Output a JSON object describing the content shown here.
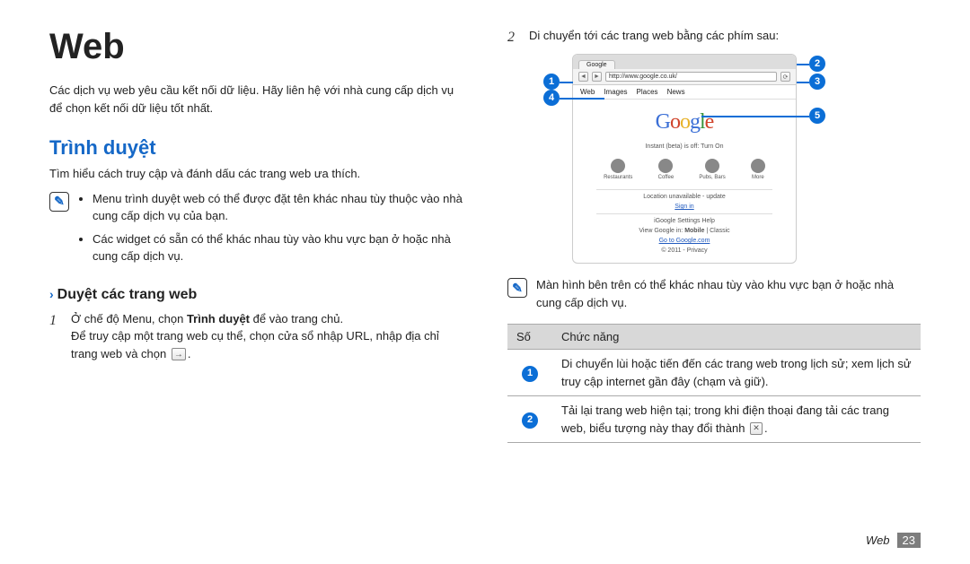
{
  "left": {
    "title": "Web",
    "intro": "Các dịch vụ web yêu cầu kết nối dữ liệu. Hãy liên hệ với nhà cung cấp dịch vụ để chọn kết nối dữ liệu tốt nhất.",
    "section_title": "Trình duyệt",
    "section_desc": "Tìm hiểu cách truy cập và đánh dấu các trang web ưa thích.",
    "notes": [
      "Menu trình duyệt web có thể được đặt tên khác nhau tùy thuộc vào nhà cung cấp dịch vụ của bạn.",
      "Các widget có sẵn có thể khác nhau tùy vào khu vực bạn ở hoặc nhà cung cấp dịch vụ."
    ],
    "sub_title": "Duyệt các trang web",
    "step1_a": "Ở chế độ Menu, chọn ",
    "step1_bold": "Trình duyệt",
    "step1_b": " để vào trang chủ.",
    "step1_c": "Để truy cập một trang web cụ thể, chọn cửa sổ nhập URL, nhập địa chỉ trang web và chọn "
  },
  "right": {
    "step2": "Di chuyển tới các trang web bằng các phím sau:",
    "mock": {
      "tab": "Google",
      "url": "http://www.google.co.uk/",
      "nav_tabs": [
        "Web",
        "Images",
        "Places",
        "News"
      ],
      "instant": "Instant (beta) is off: Turn On",
      "icons": [
        "Restaurants",
        "Coffee",
        "Pubs, Bars",
        "More"
      ],
      "loc": "Location unavailable - update",
      "signin": "Sign in",
      "links1": "iGoogle   Settings   Help",
      "view1": "View Google in: ",
      "view1b": "Mobile",
      "view1c": " | Classic",
      "goto": "Go to Google.com",
      "copy": "© 2011 - Privacy"
    },
    "callouts": [
      "1",
      "2",
      "3",
      "4",
      "5"
    ],
    "note": "Màn hình bên trên có thể khác nhau tùy vào khu vực bạn ở hoặc nhà cung cấp dịch vụ.",
    "table": {
      "headers": [
        "Số",
        "Chức năng"
      ],
      "rows": [
        {
          "n": "1",
          "t": "Di chuyển lùi hoặc tiến đến các trang web trong lịch sử; xem lịch sử truy cập internet gần đây (chạm và giữ)."
        },
        {
          "n": "2",
          "t_a": "Tải lại trang web hiện tại; trong khi điện thoại đang tải các trang web, biểu tượng này thay đổi thành ",
          "t_b": "."
        }
      ]
    }
  },
  "footer": {
    "cat": "Web",
    "pg": "23"
  }
}
